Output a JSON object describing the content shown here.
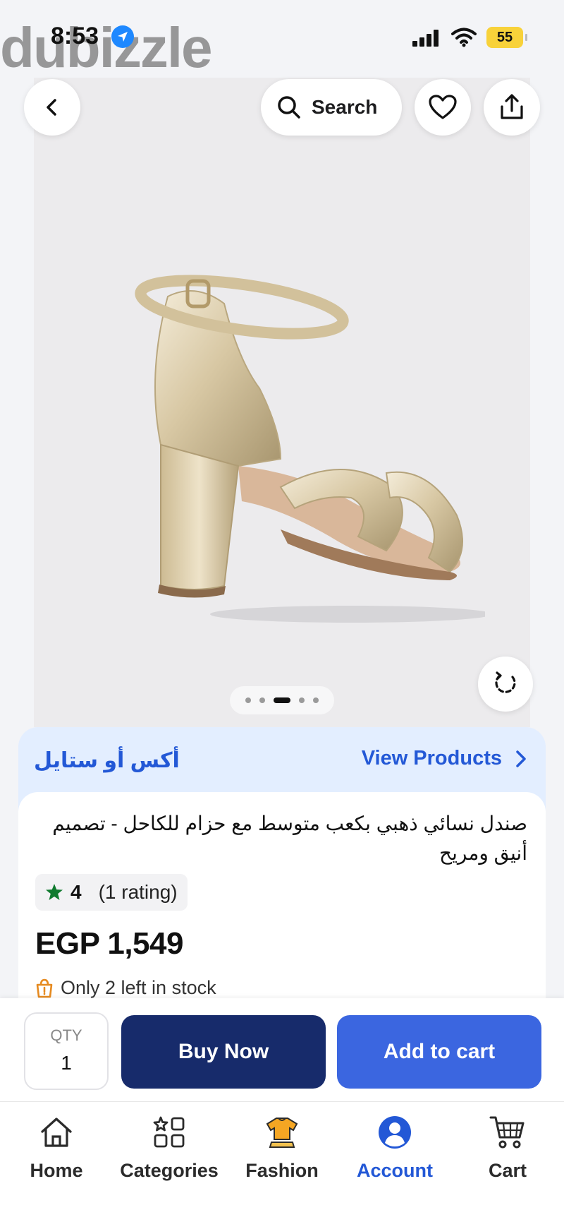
{
  "status_bar": {
    "time": "8:53",
    "battery": "55"
  },
  "watermark": "dubizzle",
  "header": {
    "search_label": "Search"
  },
  "gallery": {
    "image_count": 5,
    "active_index": 2
  },
  "seller": {
    "name": "أكس أو ستايل",
    "view_products_label": "View Products"
  },
  "product": {
    "title": "صندل نسائي ذهبي بكعب متوسط مع حزام للكاحل - تصميم أنيق ومريح",
    "rating": "4",
    "rating_count": "(1 rating)",
    "price": "EGP 1,549",
    "stock_note": "Only 2 left in stock"
  },
  "actions": {
    "qty_label": "QTY",
    "qty_value": "1",
    "buy_now_label": "Buy Now",
    "add_to_cart_label": "Add to cart"
  },
  "bottom_nav": {
    "items": [
      {
        "label": "Home",
        "icon": "home-icon"
      },
      {
        "label": "Categories",
        "icon": "categories-icon"
      },
      {
        "label": "Fashion",
        "icon": "fashion-icon"
      },
      {
        "label": "Account",
        "icon": "account-icon"
      },
      {
        "label": "Cart",
        "icon": "cart-icon"
      }
    ],
    "active": "Account"
  },
  "colors": {
    "brand_blue": "#2358d6",
    "buy_now_bg": "#172b6b",
    "add_to_cart_bg": "#3b66e0",
    "rating_star": "#0f7a2e",
    "stock_icon": "#e68a1f"
  }
}
